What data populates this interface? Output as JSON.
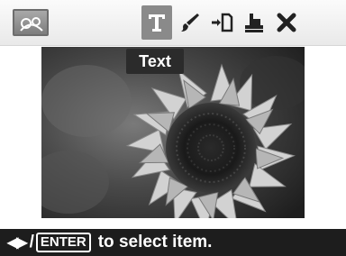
{
  "toolbar": {
    "mode_icon": "photo-edit-icon",
    "tools": [
      {
        "icon": "text-icon",
        "glyph": "T",
        "selected": true
      },
      {
        "icon": "brush-icon",
        "selected": false
      },
      {
        "icon": "import-icon",
        "selected": false
      },
      {
        "icon": "stamp-icon",
        "selected": false
      },
      {
        "icon": "close-icon",
        "glyph": "✖",
        "selected": false
      }
    ]
  },
  "tooltip": {
    "label": "Text"
  },
  "preview": {
    "subject": "sunflower"
  },
  "status_bar": {
    "arrows": "◀▶",
    "separator": "/",
    "enter_key": "ENTER",
    "hint": "to select item."
  },
  "colors": {
    "selected_bg": "#8a8a8a",
    "tooltip_bg": "#2b2b2b",
    "status_bg": "#1d1d1d"
  }
}
